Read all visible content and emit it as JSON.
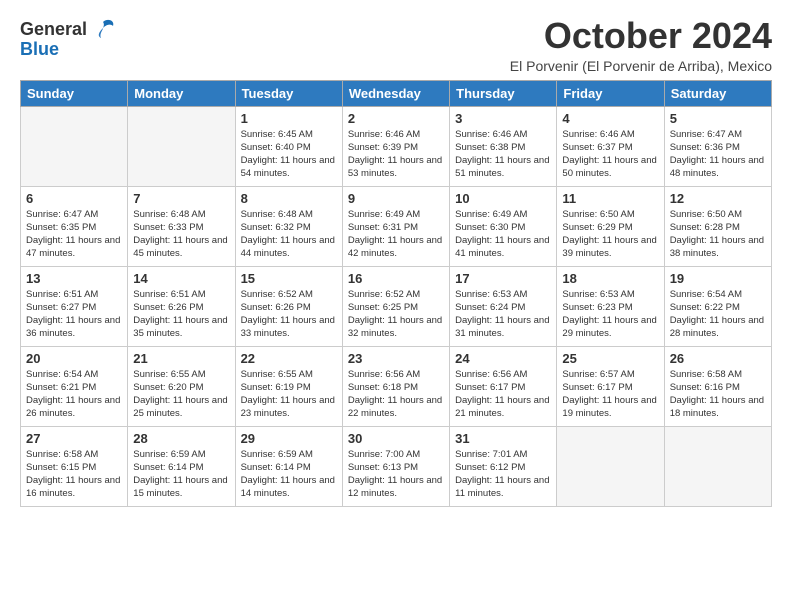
{
  "logo": {
    "line1": "General",
    "line2": "Blue"
  },
  "title": "October 2024",
  "subtitle": "El Porvenir (El Porvenir de Arriba), Mexico",
  "weekdays": [
    "Sunday",
    "Monday",
    "Tuesday",
    "Wednesday",
    "Thursday",
    "Friday",
    "Saturday"
  ],
  "weeks": [
    [
      {
        "day": "",
        "info": ""
      },
      {
        "day": "",
        "info": ""
      },
      {
        "day": "1",
        "info": "Sunrise: 6:45 AM\nSunset: 6:40 PM\nDaylight: 11 hours and 54 minutes."
      },
      {
        "day": "2",
        "info": "Sunrise: 6:46 AM\nSunset: 6:39 PM\nDaylight: 11 hours and 53 minutes."
      },
      {
        "day": "3",
        "info": "Sunrise: 6:46 AM\nSunset: 6:38 PM\nDaylight: 11 hours and 51 minutes."
      },
      {
        "day": "4",
        "info": "Sunrise: 6:46 AM\nSunset: 6:37 PM\nDaylight: 11 hours and 50 minutes."
      },
      {
        "day": "5",
        "info": "Sunrise: 6:47 AM\nSunset: 6:36 PM\nDaylight: 11 hours and 48 minutes."
      }
    ],
    [
      {
        "day": "6",
        "info": "Sunrise: 6:47 AM\nSunset: 6:35 PM\nDaylight: 11 hours and 47 minutes."
      },
      {
        "day": "7",
        "info": "Sunrise: 6:48 AM\nSunset: 6:33 PM\nDaylight: 11 hours and 45 minutes."
      },
      {
        "day": "8",
        "info": "Sunrise: 6:48 AM\nSunset: 6:32 PM\nDaylight: 11 hours and 44 minutes."
      },
      {
        "day": "9",
        "info": "Sunrise: 6:49 AM\nSunset: 6:31 PM\nDaylight: 11 hours and 42 minutes."
      },
      {
        "day": "10",
        "info": "Sunrise: 6:49 AM\nSunset: 6:30 PM\nDaylight: 11 hours and 41 minutes."
      },
      {
        "day": "11",
        "info": "Sunrise: 6:50 AM\nSunset: 6:29 PM\nDaylight: 11 hours and 39 minutes."
      },
      {
        "day": "12",
        "info": "Sunrise: 6:50 AM\nSunset: 6:28 PM\nDaylight: 11 hours and 38 minutes."
      }
    ],
    [
      {
        "day": "13",
        "info": "Sunrise: 6:51 AM\nSunset: 6:27 PM\nDaylight: 11 hours and 36 minutes."
      },
      {
        "day": "14",
        "info": "Sunrise: 6:51 AM\nSunset: 6:26 PM\nDaylight: 11 hours and 35 minutes."
      },
      {
        "day": "15",
        "info": "Sunrise: 6:52 AM\nSunset: 6:26 PM\nDaylight: 11 hours and 33 minutes."
      },
      {
        "day": "16",
        "info": "Sunrise: 6:52 AM\nSunset: 6:25 PM\nDaylight: 11 hours and 32 minutes."
      },
      {
        "day": "17",
        "info": "Sunrise: 6:53 AM\nSunset: 6:24 PM\nDaylight: 11 hours and 31 minutes."
      },
      {
        "day": "18",
        "info": "Sunrise: 6:53 AM\nSunset: 6:23 PM\nDaylight: 11 hours and 29 minutes."
      },
      {
        "day": "19",
        "info": "Sunrise: 6:54 AM\nSunset: 6:22 PM\nDaylight: 11 hours and 28 minutes."
      }
    ],
    [
      {
        "day": "20",
        "info": "Sunrise: 6:54 AM\nSunset: 6:21 PM\nDaylight: 11 hours and 26 minutes."
      },
      {
        "day": "21",
        "info": "Sunrise: 6:55 AM\nSunset: 6:20 PM\nDaylight: 11 hours and 25 minutes."
      },
      {
        "day": "22",
        "info": "Sunrise: 6:55 AM\nSunset: 6:19 PM\nDaylight: 11 hours and 23 minutes."
      },
      {
        "day": "23",
        "info": "Sunrise: 6:56 AM\nSunset: 6:18 PM\nDaylight: 11 hours and 22 minutes."
      },
      {
        "day": "24",
        "info": "Sunrise: 6:56 AM\nSunset: 6:17 PM\nDaylight: 11 hours and 21 minutes."
      },
      {
        "day": "25",
        "info": "Sunrise: 6:57 AM\nSunset: 6:17 PM\nDaylight: 11 hours and 19 minutes."
      },
      {
        "day": "26",
        "info": "Sunrise: 6:58 AM\nSunset: 6:16 PM\nDaylight: 11 hours and 18 minutes."
      }
    ],
    [
      {
        "day": "27",
        "info": "Sunrise: 6:58 AM\nSunset: 6:15 PM\nDaylight: 11 hours and 16 minutes."
      },
      {
        "day": "28",
        "info": "Sunrise: 6:59 AM\nSunset: 6:14 PM\nDaylight: 11 hours and 15 minutes."
      },
      {
        "day": "29",
        "info": "Sunrise: 6:59 AM\nSunset: 6:14 PM\nDaylight: 11 hours and 14 minutes."
      },
      {
        "day": "30",
        "info": "Sunrise: 7:00 AM\nSunset: 6:13 PM\nDaylight: 11 hours and 12 minutes."
      },
      {
        "day": "31",
        "info": "Sunrise: 7:01 AM\nSunset: 6:12 PM\nDaylight: 11 hours and 11 minutes."
      },
      {
        "day": "",
        "info": ""
      },
      {
        "day": "",
        "info": ""
      }
    ]
  ]
}
